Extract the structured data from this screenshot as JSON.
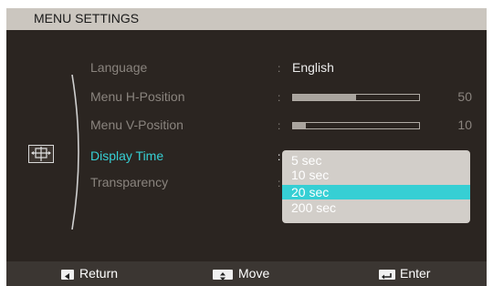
{
  "header": {
    "title": "MENU SETTINGS"
  },
  "menu": {
    "items": [
      {
        "label": "Language",
        "value": "English"
      },
      {
        "label": "Menu H-Position",
        "level": 50,
        "value": "50"
      },
      {
        "label": "Menu V-Position",
        "level": 10,
        "value": "10"
      },
      {
        "label": "Display Time"
      },
      {
        "label": "Transparency"
      }
    ],
    "colon": ":"
  },
  "dropdown": {
    "options": [
      "5 sec",
      "10 sec",
      "20 sec",
      "200 sec"
    ],
    "selected": "20 sec"
  },
  "footer": {
    "return_label": "Return",
    "move_label": "Move",
    "enter_label": "Enter"
  },
  "colors": {
    "accent": "#36cfd4",
    "header_bg": "#cbc6bf",
    "body_bg": "#2b2521"
  },
  "icons": {
    "category": "display-position-icon"
  }
}
